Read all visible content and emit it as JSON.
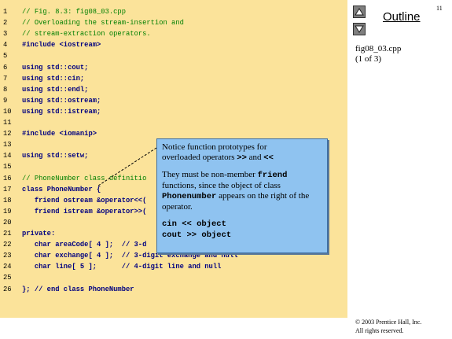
{
  "page_number": "11",
  "nav": {
    "up_icon": "triangle-up-icon",
    "down_icon": "triangle-down-icon",
    "outline_label": "Outline"
  },
  "file": {
    "name": "fig08_03.cpp",
    "part": "(1 of 3)"
  },
  "code_lines": [
    {
      "num": "1",
      "text": "// Fig. 8.3: fig08_03.cpp",
      "kind": "comment"
    },
    {
      "num": "2",
      "text": "// Overloading the stream-insertion and",
      "kind": "comment"
    },
    {
      "num": "3",
      "text": "// stream-extraction operators.",
      "kind": "comment"
    },
    {
      "num": "4",
      "text": "#include <iostream>",
      "kind": "code"
    },
    {
      "num": "5",
      "text": "",
      "kind": "code"
    },
    {
      "num": "6",
      "text": "using std::cout;",
      "kind": "code"
    },
    {
      "num": "7",
      "text": "using std::cin;",
      "kind": "code"
    },
    {
      "num": "8",
      "text": "using std::endl;",
      "kind": "code"
    },
    {
      "num": "9",
      "text": "using std::ostream;",
      "kind": "code"
    },
    {
      "num": "10",
      "text": "using std::istream;",
      "kind": "code"
    },
    {
      "num": "11",
      "text": "",
      "kind": "code"
    },
    {
      "num": "12",
      "text": "#include <iomanip>",
      "kind": "code"
    },
    {
      "num": "13",
      "text": "",
      "kind": "code"
    },
    {
      "num": "14",
      "text": "using std::setw;",
      "kind": "code"
    },
    {
      "num": "15",
      "text": "",
      "kind": "code"
    },
    {
      "num": "16",
      "text": "// PhoneNumber class definitio",
      "kind": "comment"
    },
    {
      "num": "17",
      "text": "class PhoneNumber {",
      "kind": "code"
    },
    {
      "num": "18",
      "text": "   friend ostream &operator<<(",
      "kind": "code"
    },
    {
      "num": "19",
      "text": "   friend istream &operator>>(",
      "kind": "code"
    },
    {
      "num": "20",
      "text": "",
      "kind": "code"
    },
    {
      "num": "21",
      "text": "private:",
      "kind": "code"
    },
    {
      "num": "22",
      "text": "   char areaCode[ 4 ];  // 3-d",
      "kind": "code"
    },
    {
      "num": "23",
      "text": "   char exchange[ 4 ];  // 3-digit exchange and null",
      "kind": "code"
    },
    {
      "num": "24",
      "text": "   char line[ 5 ];      // 4-digit line and null",
      "kind": "code"
    },
    {
      "num": "25",
      "text": "",
      "kind": "code"
    },
    {
      "num": "26",
      "text": "}; // end class PhoneNumber",
      "kind": "code"
    }
  ],
  "callout": {
    "line1": "Notice function prototypes for",
    "line2_prefix": "overloaded operators ",
    "line2_op1": ">>",
    "line2_mid": " and ",
    "line2_op2": "<<",
    "p2_prefix": "They must be non-member ",
    "p2_friend": "friend",
    "p2_mid": " functions, since the object of class ",
    "p2_class": "Phonenumber",
    "p2_suffix": " appears on the right of the operator.",
    "code1": "cin << object",
    "code2": "cout >> object"
  },
  "copyright": {
    "line1": "© 2003 Prentice Hall, Inc.",
    "line2": "All rights reserved."
  }
}
